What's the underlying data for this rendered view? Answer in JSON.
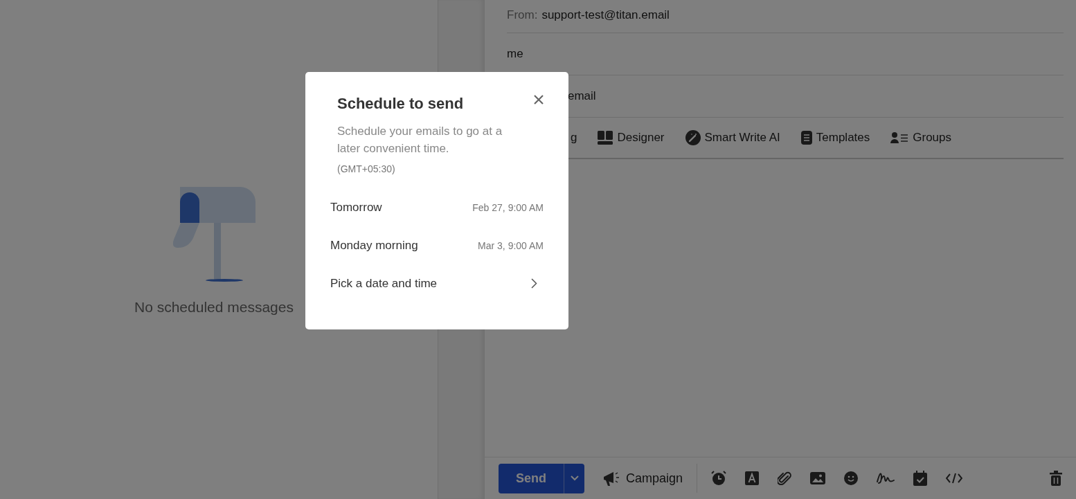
{
  "sidebar": {
    "empty_message": "No scheduled messages"
  },
  "compose": {
    "from_label": "From:",
    "from_value": "support-test@titan.email",
    "to_value": "me",
    "subject_value": "email",
    "toolbar": [
      {
        "label": "g",
        "kind": "text"
      },
      {
        "label": "Designer",
        "kind": "designer"
      },
      {
        "label": "Smart Write AI",
        "kind": "ai"
      },
      {
        "label": "Templates",
        "kind": "templates"
      },
      {
        "label": "Groups",
        "kind": "groups"
      }
    ],
    "send_button": "Send",
    "campaign_button": "Campaign"
  },
  "modal": {
    "title": "Schedule to send",
    "description": "Schedule your emails to go at a later convenient time.",
    "timezone": "(GMT+05:30)",
    "options": [
      {
        "label": "Tomorrow",
        "time": "Feb 27, 9:00 AM",
        "kind": "preset"
      },
      {
        "label": "Monday morning",
        "time": "Mar 3, 9:00 AM",
        "kind": "preset"
      },
      {
        "label": "Pick a date and time",
        "kind": "picker"
      }
    ]
  }
}
